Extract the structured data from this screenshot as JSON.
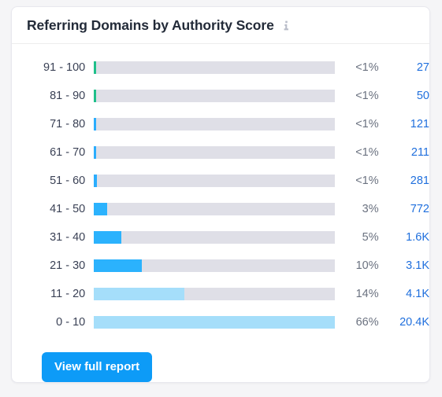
{
  "card": {
    "title": "Referring Domains by Authority Score",
    "info_icon": "info-icon",
    "footer": {
      "view_full_report_label": "View full report"
    }
  },
  "colors": {
    "green": "#1fc08a",
    "blue": "#2badfd",
    "bright_blue": "#2bb2fd",
    "light_blue": "#a5defa",
    "track": "#dfdfe7",
    "value_link": "#1f6fdd",
    "percent_text": "#6b7280",
    "button": "#0d9bf7"
  },
  "chart_data": {
    "type": "bar",
    "title": "Referring Domains by Authority Score",
    "xlabel": "",
    "ylabel": "Authority Score",
    "orientation": "horizontal",
    "xlim": [
      0,
      100
    ],
    "grid": false,
    "legend": "none",
    "categories": [
      "91 - 100",
      "81 - 90",
      "71 - 80",
      "61 - 70",
      "51 - 60",
      "41 - 50",
      "31 - 40",
      "21 - 30",
      "11 - 20",
      "0 - 10"
    ],
    "percent_labels": [
      "<1%",
      "<1%",
      "<1%",
      "<1%",
      "<1%",
      "3%",
      "5%",
      "10%",
      "14%",
      "66%"
    ],
    "values": [
      27,
      50,
      121,
      211,
      281,
      772,
      1600,
      3100,
      4100,
      20400
    ],
    "value_labels": [
      "27",
      "50",
      "121",
      "211",
      "281",
      "772",
      "1.6K",
      "3.1K",
      "4.1K",
      "20.4K"
    ],
    "bar_percents": [
      0.9,
      0.9,
      0.9,
      0.9,
      1.2,
      5.5,
      11.5,
      20,
      37.5,
      100
    ],
    "bar_colors": [
      "#1fc08a",
      "#1fc08a",
      "#2badfd",
      "#2badfd",
      "#2badfd",
      "#2bb2fd",
      "#2bb2fd",
      "#2bb2fd",
      "#a5defa",
      "#a5defa"
    ],
    "rows": [
      {
        "label": "91 - 100",
        "percent": "<1%",
        "value": "27",
        "bar_percent": 0.9,
        "color": "#1fc08a"
      },
      {
        "label": "81 - 90",
        "percent": "<1%",
        "value": "50",
        "bar_percent": 0.9,
        "color": "#1fc08a"
      },
      {
        "label": "71 - 80",
        "percent": "<1%",
        "value": "121",
        "bar_percent": 0.9,
        "color": "#2badfd"
      },
      {
        "label": "61 - 70",
        "percent": "<1%",
        "value": "211",
        "bar_percent": 0.9,
        "color": "#2badfd"
      },
      {
        "label": "51 - 60",
        "percent": "<1%",
        "value": "281",
        "bar_percent": 1.2,
        "color": "#2badfd"
      },
      {
        "label": "41 - 50",
        "percent": "3%",
        "value": "772",
        "bar_percent": 5.5,
        "color": "#2bb2fd"
      },
      {
        "label": "31 - 40",
        "percent": "5%",
        "value": "1.6K",
        "bar_percent": 11.5,
        "color": "#2bb2fd"
      },
      {
        "label": "21 - 30",
        "percent": "10%",
        "value": "3.1K",
        "bar_percent": 20.0,
        "color": "#2bb2fd"
      },
      {
        "label": "11 - 20",
        "percent": "14%",
        "value": "4.1K",
        "bar_percent": 37.5,
        "color": "#a5defa"
      },
      {
        "label": "0 - 10",
        "percent": "66%",
        "value": "20.4K",
        "bar_percent": 100,
        "color": "#a5defa"
      }
    ]
  }
}
